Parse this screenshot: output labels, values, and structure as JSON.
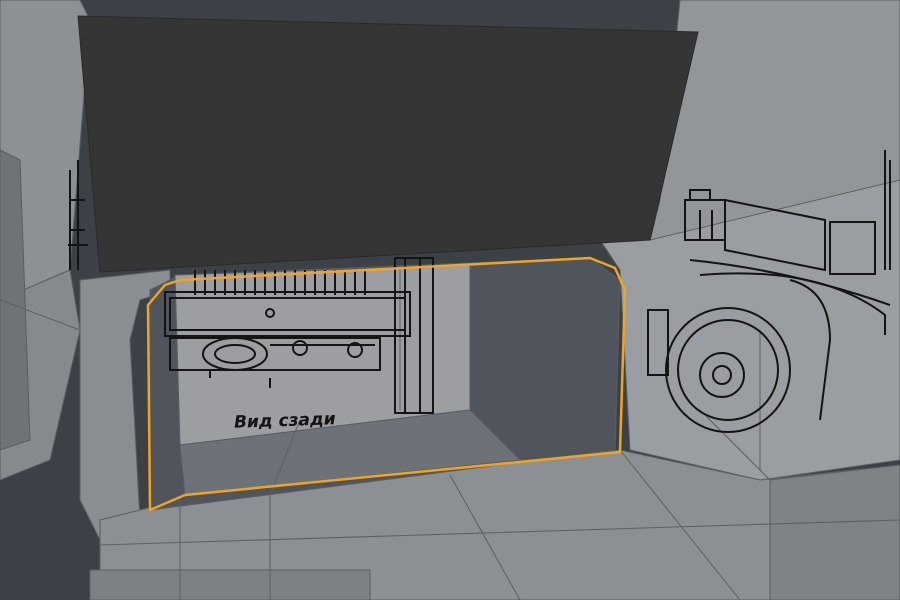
{
  "viewport": {
    "blueprint_label": "Вид сзади"
  },
  "colors": {
    "background": "#3c4148",
    "mesh_surface": "#8c8f94",
    "mesh_light": "#9a9da1",
    "mesh_dark": "#6f7378",
    "wireframe": "#55595e",
    "overlay_panel": "#353535",
    "selection": "#f2a320",
    "blueprint_ink": "#141414",
    "shadow": "#4b5058"
  },
  "icons": {
    "blueprint_front": "truck-rear-view-drawing",
    "blueprint_side": "truck-side-view-drawing"
  }
}
